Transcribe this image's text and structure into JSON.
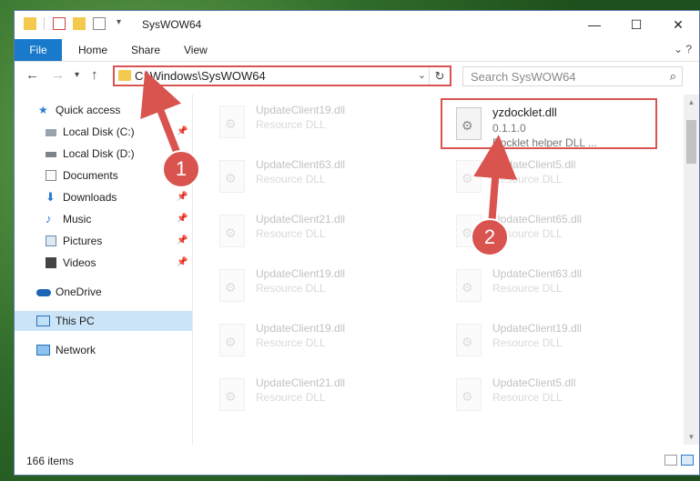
{
  "window": {
    "title": "SysWOW64",
    "controls": {
      "minimize": "—",
      "maximize": "☐",
      "close": "✕"
    }
  },
  "ribbon": {
    "tabs": [
      "File",
      "Home",
      "Share",
      "View"
    ],
    "expand": "⌄ ?"
  },
  "address": {
    "path": "C:\\Windows\\SysWOW64",
    "search_placeholder": "Search SysWOW64"
  },
  "navpane": {
    "items": [
      {
        "label": "Quick access",
        "icon": "star-icon",
        "pinned": false
      },
      {
        "label": "Local Disk (C:)",
        "icon": "drive-icon",
        "pinned": true
      },
      {
        "label": "Local Disk (D:)",
        "icon": "drive-icon",
        "pinned": false
      },
      {
        "label": "Documents",
        "icon": "documents-icon",
        "pinned": true
      },
      {
        "label": "Downloads",
        "icon": "download-icon",
        "pinned": true
      },
      {
        "label": "Music",
        "icon": "music-icon",
        "pinned": true
      },
      {
        "label": "Pictures",
        "icon": "pictures-icon",
        "pinned": true
      },
      {
        "label": "Videos",
        "icon": "videos-icon",
        "pinned": true
      },
      {
        "label": "OneDrive",
        "icon": "cloud-icon",
        "pinned": false
      },
      {
        "label": "This PC",
        "icon": "computer-icon",
        "pinned": false,
        "selected": true
      },
      {
        "label": "Network",
        "icon": "network-icon",
        "pinned": false
      }
    ]
  },
  "files": {
    "highlighted": {
      "name": "yzdocklet.dll",
      "version": "0.1.1.0",
      "description": "Docklet helper DLL ..."
    },
    "faded": [
      {
        "name": "UpdateClient19.dll",
        "type": "Resource DLL"
      },
      {
        "name": "UpdateClient63.dll",
        "type": "Resource DLL"
      },
      {
        "name": "UpdateClient5.dll",
        "type": "Resource DLL"
      },
      {
        "name": "UpdateClient21.dll",
        "type": "Resource DLL"
      },
      {
        "name": "UpdateClient65.dll",
        "type": "Resource DLL"
      },
      {
        "name": "UpdateClient19.dll",
        "type": "Resource DLL"
      },
      {
        "name": "UpdateClient63.dll",
        "type": "Resource DLL"
      },
      {
        "name": "UpdateClient19.dll",
        "type": "Resource DLL"
      },
      {
        "name": "UpdateClient19.dll",
        "type": "Resource DLL"
      },
      {
        "name": "UpdateClient21.dll",
        "type": "Resource DLL"
      },
      {
        "name": "UpdateClient5.dll",
        "type": "Resource DLL"
      }
    ]
  },
  "status": {
    "items": "166 items"
  },
  "callouts": [
    "1",
    "2"
  ],
  "colors": {
    "accent": "#1979ca",
    "highlight": "#d9534f",
    "selected": "#cce4f7"
  }
}
